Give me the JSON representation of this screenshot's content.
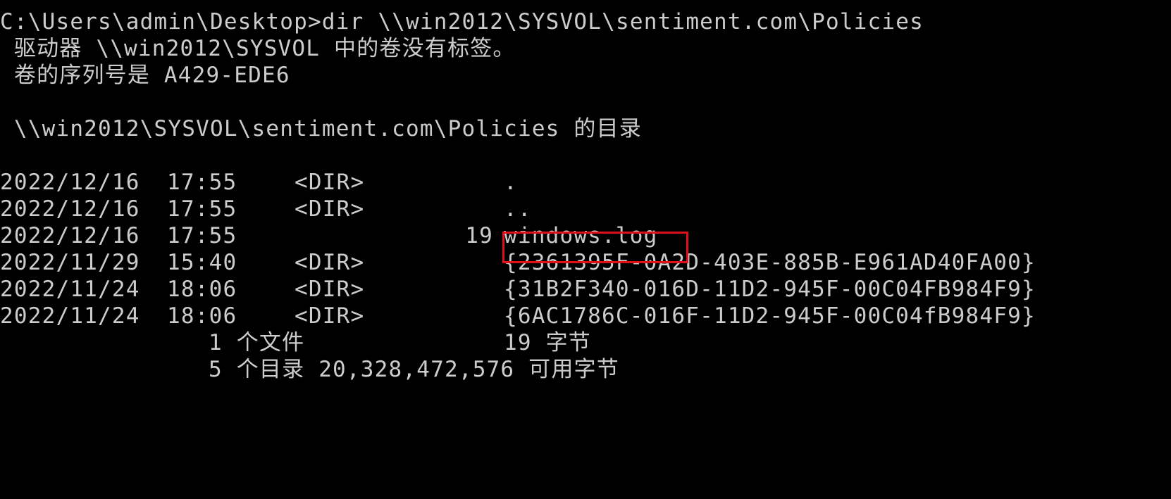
{
  "console": {
    "command_line": "C:\\Users\\admin\\Desktop>dir \\\\win2012\\SYSVOL\\sentiment.com\\Policies",
    "volume_label_line": " 驱动器 \\\\win2012\\SYSVOL 中的卷没有标签。",
    "volume_serial_line": " 卷的序列号是 A429-EDE6",
    "directory_of_line": " \\\\win2012\\SYSVOL\\sentiment.com\\Policies 的目录",
    "entries": [
      {
        "date": "2022/12/16",
        "time": "17:55",
        "type": "<DIR>",
        "size": "",
        "name": "."
      },
      {
        "date": "2022/12/16",
        "time": "17:55",
        "type": "<DIR>",
        "size": "",
        "name": ".."
      },
      {
        "date": "2022/12/16",
        "time": "17:55",
        "type": "",
        "size": "19",
        "name": "windows.log"
      },
      {
        "date": "2022/11/29",
        "time": "15:40",
        "type": "<DIR>",
        "size": "",
        "name": "{2361395F-0A2D-403E-885B-E961AD40FA00}"
      },
      {
        "date": "2022/11/24",
        "time": "18:06",
        "type": "<DIR>",
        "size": "",
        "name": "{31B2F340-016D-11D2-945F-00C04FB984F9}"
      },
      {
        "date": "2022/11/24",
        "time": "18:06",
        "type": "<DIR>",
        "size": "",
        "name": "{6AC1786C-016F-11D2-945F-00C04fB984F9}"
      }
    ],
    "summary": {
      "files_line": "1 个文件",
      "files_bytes": "19 字节",
      "dirs_line": "5 个目录 20,328,472,576 可用字节"
    },
    "highlight_color": "#e0101a",
    "text_color": "#cccccc",
    "background_color": "#000000"
  }
}
